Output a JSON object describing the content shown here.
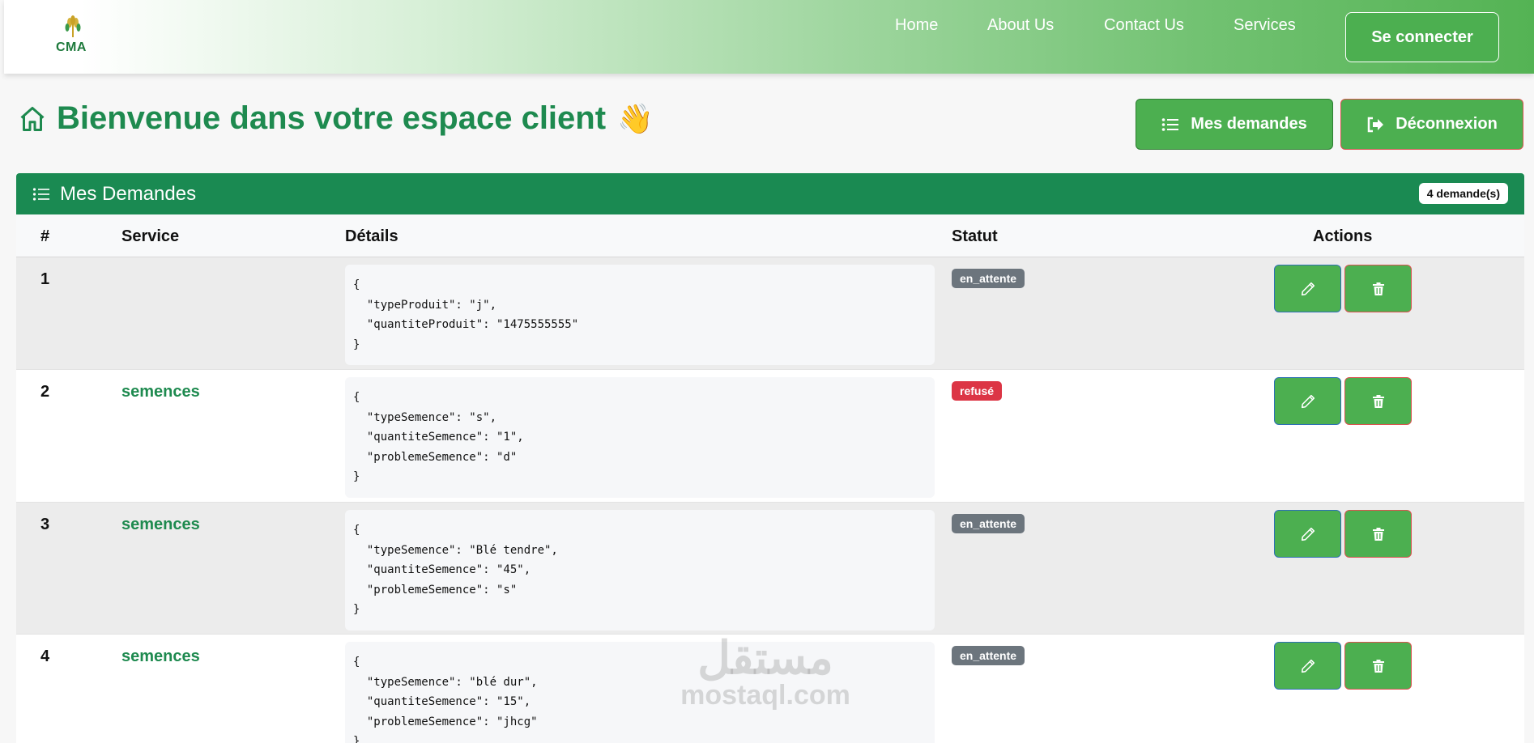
{
  "navbar": {
    "logo_text": "CMA",
    "links": [
      "Home",
      "About Us",
      "Contact Us",
      "Services"
    ],
    "connect_label": "Se connecter"
  },
  "header": {
    "title": "Bienvenue dans votre espace client",
    "wave": "👋",
    "mes_demandes_label": "Mes demandes",
    "logout_label": "Déconnexion"
  },
  "card": {
    "title": "Mes Demandes",
    "count_badge": "4 demande(s)"
  },
  "table": {
    "columns": [
      "#",
      "Service",
      "Détails",
      "Statut",
      "Actions"
    ],
    "rows": [
      {
        "num": "1",
        "service": "",
        "details": "{\n  \"typeProduit\": \"j\",\n  \"quantiteProduit\": \"1475555555\"\n}",
        "status": "en_attente"
      },
      {
        "num": "2",
        "service": "semences",
        "details": "{\n  \"typeSemence\": \"s\",\n  \"quantiteSemence\": \"1\",\n  \"problemeSemence\": \"d\"\n}",
        "status": "refusé"
      },
      {
        "num": "3",
        "service": "semences",
        "details": "{\n  \"typeSemence\": \"Blé tendre\",\n  \"quantiteSemence\": \"45\",\n  \"problemeSemence\": \"s\"\n}",
        "status": "en_attente"
      },
      {
        "num": "4",
        "service": "semences",
        "details": "{\n  \"typeSemence\": \"blé dur\",\n  \"quantiteSemence\": \"15\",\n  \"problemeSemence\": \"jhcg\"\n}",
        "status": "en_attente"
      }
    ]
  },
  "watermark": {
    "arabic": "مستقل",
    "latin": "mostaql.com"
  },
  "colors": {
    "brand_green": "#1a8a52",
    "button_green": "#4caf50",
    "status_wait": "#6c757d",
    "status_refused": "#dc3545"
  },
  "icons": [
    "home-icon",
    "list-icon",
    "logout-icon",
    "pencil-icon",
    "trash-icon"
  ]
}
